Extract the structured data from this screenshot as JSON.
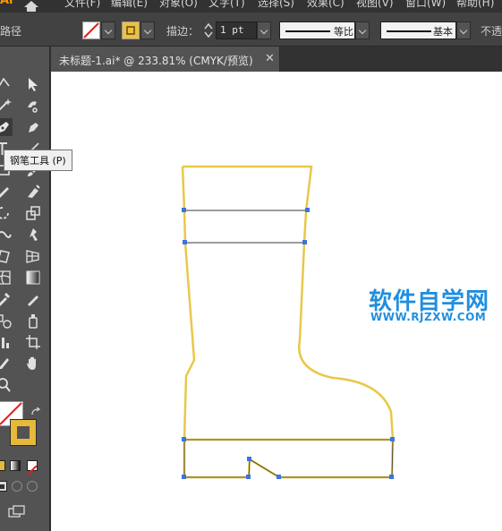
{
  "app": {
    "logo": "Ai"
  },
  "menubar": {
    "items": [
      "文件(F)",
      "编辑(E)",
      "对象(O)",
      "文字(T)",
      "选择(S)",
      "效果(C)",
      "视图(V)",
      "窗口(W)",
      "帮助(H)"
    ]
  },
  "control_bar": {
    "selection_label": "路径",
    "stroke_label": "描边：",
    "stroke_weight": "1 pt",
    "variable_width_profile": "等比",
    "brush_definition": "基本",
    "opacity_label": "不透"
  },
  "colors": {
    "stroke_color": "#f0c040",
    "fill_color": "none",
    "anchor_color": "#3b74e0",
    "path_color": "#e8c84a"
  },
  "document_tab": {
    "title": "未标题-1.ai* @ 233.81% (CMYK/预览)",
    "close": "✕"
  },
  "tooltip": {
    "text": "钢笔工具 (P)"
  },
  "watermark": {
    "line1": "软件自学网",
    "line2": "WWW.RJZXW.COM"
  },
  "tools": [
    "selection-tool-icon",
    "direct-selection-tool-icon",
    "magic-wand-tool-icon",
    "lasso-tool-icon",
    "pen-tool-icon",
    "curvature-tool-icon",
    "type-tool-icon",
    "line-segment-tool-icon",
    "rectangle-tool-icon",
    "paintbrush-tool-icon",
    "shaper-tool-icon",
    "pencil-tool-icon",
    "rotate-tool-icon",
    "scale-tool-icon",
    "warp-tool-icon",
    "free-transform-tool-icon",
    "shape-builder-tool-icon",
    "perspective-grid-tool-icon",
    "mesh-tool-icon",
    "gradient-tool-icon",
    "eyedropper-tool-icon",
    "blend-tool-icon",
    "symbol-sprayer-tool-icon",
    "column-graph-tool-icon",
    "artboard-tool-icon",
    "slice-tool-icon",
    "hand-tool-icon",
    "zoom-tool-icon"
  ]
}
